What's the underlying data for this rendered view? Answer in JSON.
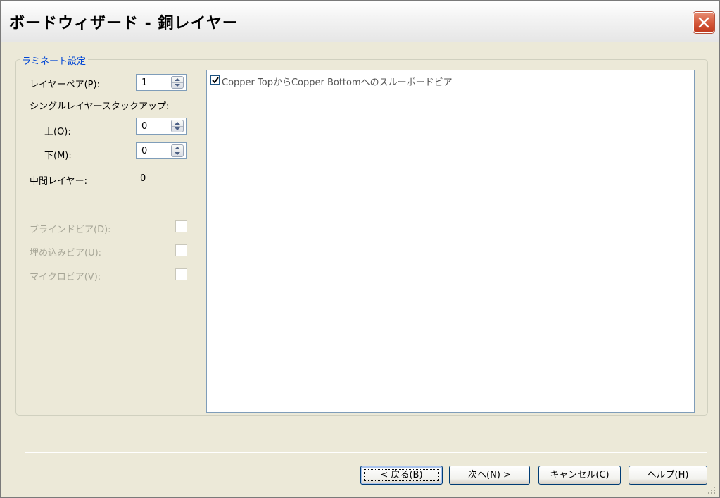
{
  "window": {
    "title": "ボードウィザード - 銅レイヤー"
  },
  "group": {
    "title": "ラミネート設定",
    "layer_pair_label": "レイヤーペア(P):",
    "layer_pair_value": "1",
    "single_stackup_label": "シングルレイヤースタックアップ:",
    "top_label": "上(O):",
    "top_value": "0",
    "bottom_label": "下(M):",
    "bottom_value": "0",
    "middle_label": "中間レイヤー:",
    "middle_value": "0",
    "blind_via_label": "ブラインドビア(D):",
    "buried_via_label": "埋め込みビア(U):",
    "micro_via_label": "マイクロビア(V):",
    "blind_via_checked": false,
    "buried_via_checked": false,
    "micro_via_checked": false
  },
  "via_list": [
    {
      "label": "Copper TopからCopper Bottomへのスルーボードビア",
      "checked": true
    }
  ],
  "buttons": {
    "back": "< 戻る(B)",
    "next": "次へ(N) >",
    "cancel": "キャンセル(C)",
    "help": "ヘルプ(H)"
  },
  "colors": {
    "dialog_background": "#ece9d8",
    "group_title": "#0046d5",
    "disabled_text": "#a7a697",
    "close_button": "#d55a3c"
  }
}
